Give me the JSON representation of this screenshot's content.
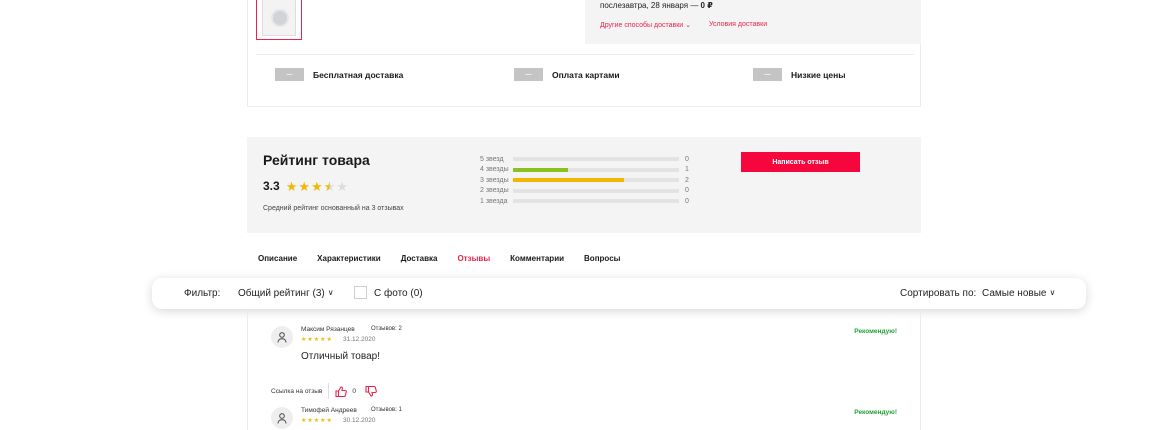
{
  "delivery": {
    "line_prefix": "послезавтра, 28 января — ",
    "line_price": "0 ₽",
    "other_methods": "Другие способы доставки",
    "conditions": "Условия доставки"
  },
  "benefits": [
    {
      "label": "Бесплатная доставка"
    },
    {
      "label": "Оплата картами"
    },
    {
      "label": "Низкие цены"
    }
  ],
  "rating": {
    "title": "Рейтинг товара",
    "score": "3.3",
    "score_value": 3.3,
    "subtitle": "Средний рейтинг основанный на 3 отзывах",
    "write_review": "Написать отзыв",
    "total": 3,
    "bars": [
      {
        "label": "5 звезд",
        "count": "0",
        "value": 0,
        "color": "#e3e3e3"
      },
      {
        "label": "4 звезды",
        "count": "1",
        "value": 1,
        "color": "#8bc11f"
      },
      {
        "label": "3 звезды",
        "count": "2",
        "value": 2,
        "color": "#f2b705"
      },
      {
        "label": "2 звезды",
        "count": "0",
        "value": 0,
        "color": "#e3e3e3"
      },
      {
        "label": "1 звезда",
        "count": "0",
        "value": 0,
        "color": "#e3e3e3"
      }
    ]
  },
  "tabs": [
    {
      "label": "Описание",
      "active": false
    },
    {
      "label": "Характеристики",
      "active": false
    },
    {
      "label": "Доставка",
      "active": false
    },
    {
      "label": "Отзывы",
      "active": true
    },
    {
      "label": "Комментарии",
      "active": false
    },
    {
      "label": "Вопросы",
      "active": false
    }
  ],
  "filter": {
    "label": "Фильтр:",
    "rating_select": "Общий рейтинг (3)",
    "photo_label": "С фото (0)",
    "sort_label": "Сортировать по:",
    "sort_value": "Самые новые"
  },
  "reviews": [
    {
      "name": "Максим Рязанцев",
      "count": "Отзывов: 2",
      "stars": "★★★★★",
      "date": "31.12.2020",
      "recommend": "Рекомендую!",
      "text": "Отличный товар!"
    },
    {
      "name": "Тимофей Андреев",
      "count": "Отзывов: 1",
      "stars": "★★★★★",
      "date": "30.12.2020",
      "recommend": "Рекомендую!",
      "text": ""
    }
  ],
  "review_actions": {
    "link_label": "Ссылка на отзыв",
    "likes": "0"
  },
  "colors": {
    "accent": "#e8254a",
    "button": "#f5073e",
    "recommend": "#21a038",
    "star": "#f2b705"
  },
  "icons": {
    "chevron": "chevron-down-icon",
    "user": "user-icon",
    "like": "thumbs-up-icon",
    "dislike": "thumbs-down-icon"
  }
}
